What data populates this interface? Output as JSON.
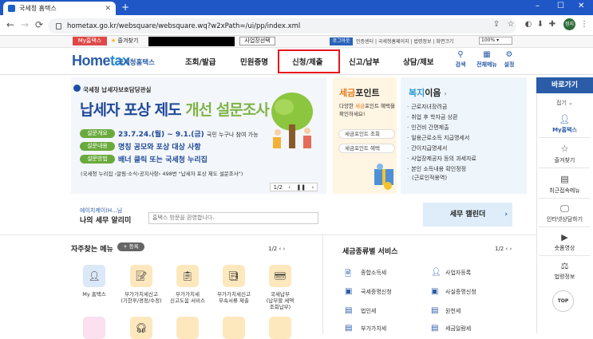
{
  "browser": {
    "tab_title": "국세청 홈택스",
    "url": "hometax.go.kr/websquare/websquare.wq?w2xPath=/ui/pp/index.xml",
    "profile": "정지"
  },
  "util": {
    "mytax": "My홈택스",
    "favorites": "즐겨찾기",
    "biz_select": "사업장선택",
    "logout": "로그아웃",
    "links": "인증센터 | 국세청홈페이지 | 법령정보 | 화면크기",
    "zoom": "100%"
  },
  "header": {
    "logo_home": "Home",
    "logo_tax": "tax",
    "logo_sub": "국세청홈택스",
    "gnb": [
      "조회/발급",
      "민원증명",
      "신청/제출",
      "신고/납부",
      "상담/제보"
    ],
    "search": "검색",
    "allmenu": "전체메뉴",
    "settings": "설정"
  },
  "banner": {
    "org": "국세청 납세자보호담당관실",
    "title_a": "납세자 포상 제도 ",
    "title_b": "개선 설문조사",
    "rows": [
      {
        "label": "설문개요",
        "value": "23.7.24.(월) ~ 9.1.(금)",
        "note": "국민 누구나 참여 가능"
      },
      {
        "label": "설문내용",
        "value": "명칭 공모와 포상 대상 사항",
        "note": ""
      },
      {
        "label": "설문방법",
        "value": "배너 클릭 또는 국세청 누리집",
        "note": ""
      }
    ],
    "footer": "(국세청 누리집 ›알림·소식›공지사항› 498번 \"납세자 포상 제도 설문조사\")",
    "pager": "1/2"
  },
  "point": {
    "title_a": "세금",
    "title_b": "포인트",
    "desc_a": "다양한 ",
    "desc_b": "세금",
    "desc_c": "포인트 혜택을 확인하세요!",
    "btn1": "세금포인트 조회",
    "btn2": "세금포인트 혜택"
  },
  "welfare": {
    "title_a": "복지",
    "title_b": "이음",
    "items": [
      "근로자녀장려금",
      "취업 후 학자금 상환",
      "인건비 간편제출",
      "일용근로소득 지급명세서",
      "간이지급명세서",
      "사업장제공자 등의 과세자료",
      "본인 소득내용 확인정정",
      "(근로인적용역)"
    ]
  },
  "quick": {
    "title": "바로가기",
    "fold": "접기",
    "items": [
      "My홈택스",
      "즐겨찾기",
      "최근접속메뉴",
      "인터넷상담하기",
      "숏폼영상",
      "법령정보"
    ],
    "top": "TOP"
  },
  "alert": {
    "user": "에이치케이(H...님",
    "title": "나의 세무 알리미",
    "message": "홈택스 방문을 환영합니다.",
    "calendar": "세무 캘린더"
  },
  "favmenu": {
    "title": "자주찾는 메뉴",
    "register": "+ 등록",
    "pager": "1/2",
    "items": [
      {
        "label": "My 홈택스"
      },
      {
        "label": "부가가치세신고\n(기한후/경정/수정)"
      },
      {
        "label": "부가가치세\n신고도움 서비스"
      },
      {
        "label": "부가가치세신고\n부속서류 제출"
      },
      {
        "label": "국세납부\n(납부할 세액\n조회납부)"
      }
    ]
  },
  "taxservice": {
    "title": "세금종류별 서비스",
    "pager": "1/2",
    "items": [
      "종합소득세",
      "사업자등록",
      "국세증명신청",
      "사실증명신청",
      "법인세",
      "원천세",
      "부가가치세",
      "세금일람세"
    ]
  }
}
